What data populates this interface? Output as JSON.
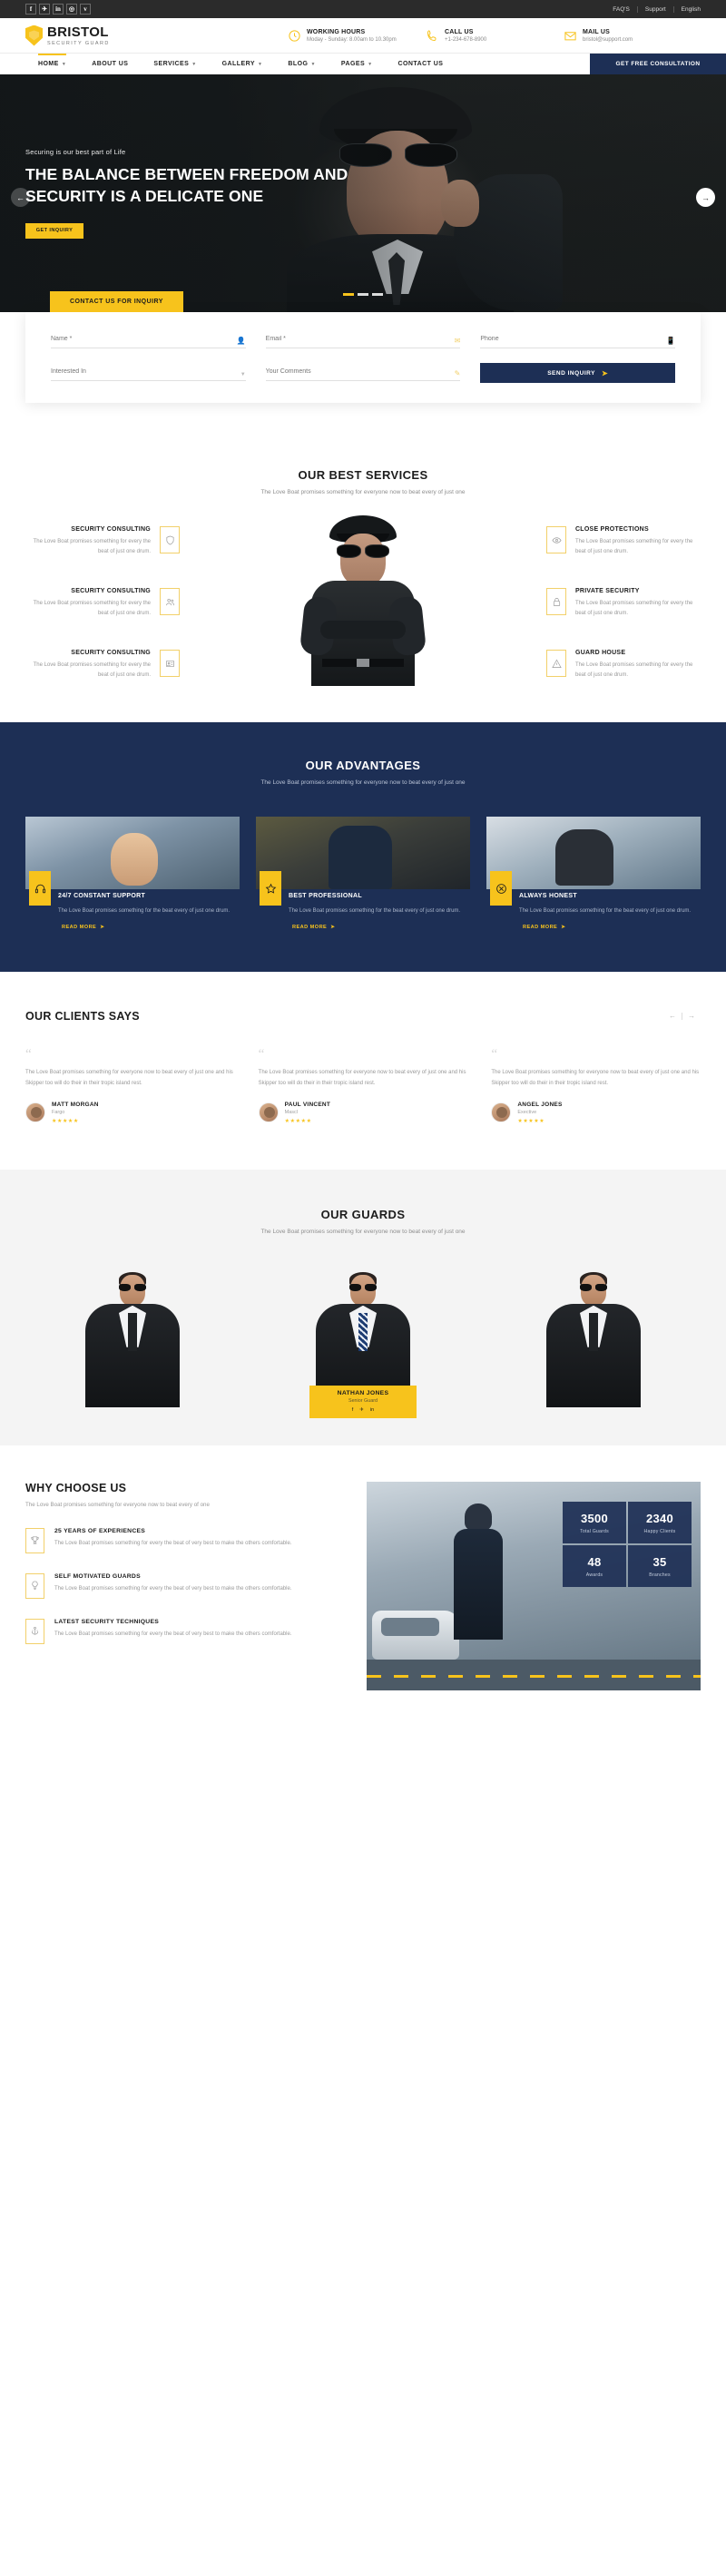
{
  "topbar": {
    "socials": [
      {
        "name": "facebook-icon",
        "glyph": "f"
      },
      {
        "name": "twitter-icon",
        "glyph": "✈"
      },
      {
        "name": "linkedin-icon",
        "glyph": "in"
      },
      {
        "name": "instagram-icon",
        "glyph": "◎"
      },
      {
        "name": "vimeo-icon",
        "glyph": "v"
      }
    ],
    "links": [
      "FAQ'S",
      "Support",
      "English"
    ]
  },
  "header": {
    "logo_main": "BRISTOL",
    "logo_sub": "SECURITY GUARD",
    "info": [
      {
        "title": "WORKING HOURS",
        "sub": "Moday - Sunday: 8.00am to 10.30pm",
        "icon": "clock-icon"
      },
      {
        "title": "CALL US",
        "sub": "+1-234-678-8900",
        "icon": "phone-icon"
      },
      {
        "title": "MAIL US",
        "sub": "bristol@support.com",
        "icon": "mail-icon"
      }
    ]
  },
  "nav": {
    "items": [
      {
        "label": "HOME",
        "caret": true,
        "active": true
      },
      {
        "label": "ABOUT US",
        "caret": false,
        "active": false
      },
      {
        "label": "SERVICES",
        "caret": true,
        "active": false
      },
      {
        "label": "GALLERY",
        "caret": true,
        "active": false
      },
      {
        "label": "BLOG",
        "caret": true,
        "active": false
      },
      {
        "label": "PAGES",
        "caret": true,
        "active": false
      },
      {
        "label": "CONTACT US",
        "caret": false,
        "active": false
      }
    ],
    "cta": "GET FREE CONSULTATION"
  },
  "hero": {
    "kicker": "Securing is our best part of Life",
    "title": "THE BALANCE BETWEEN FREEDOM AND SECURITY IS A DELICATE ONE",
    "cta": "GET INQUIRY",
    "prev": "←",
    "next": "→"
  },
  "inquiry": {
    "tab": "CONTACT US FOR INQUIRY",
    "fields": {
      "name": "Name *",
      "email": "Email *",
      "phone": "Phone",
      "interested": "Interested In",
      "comments": "Your Comments"
    },
    "submit": "SEND INQUIRY"
  },
  "services": {
    "title": "OUR BEST SERVICES",
    "subtitle": "The Love Boat promises something for everyone now to beat every of just one",
    "left": [
      {
        "name": "SECURITY CONSULTING",
        "desc": "The Love Boat promises something for every the beat of just one drum.",
        "icon": "shield-icon"
      },
      {
        "name": "SECURITY CONSULTING",
        "desc": "The Love Boat promises something for every the beat of just one drum.",
        "icon": "people-icon"
      },
      {
        "name": "SECURITY CONSULTING",
        "desc": "The Love Boat promises something for every the beat of just one drum.",
        "icon": "card-icon"
      }
    ],
    "right": [
      {
        "name": "CLOSE PROTECTIONS",
        "desc": "The Love Boat promises something for every the beat of just one drum.",
        "icon": "eye-icon"
      },
      {
        "name": "PRIVATE SECURITY",
        "desc": "The Love Boat promises something for every the beat of just one drum.",
        "icon": "lock-icon"
      },
      {
        "name": "GUARD HOUSE",
        "desc": "The Love Boat promises something for every the beat of just one drum.",
        "icon": "warning-icon"
      }
    ]
  },
  "advantages": {
    "title": "OUR ADVANTAGES",
    "subtitle": "The Love Boat promises something for everyone now to beat every of just one",
    "cards": [
      {
        "title": "24/7 CONSTANT SUPPORT",
        "desc": "The Love Boat promises something for the beat every of just one drum.",
        "more": "READ MORE",
        "icon": "headphones-icon"
      },
      {
        "title": "BEST PROFESSIONAL",
        "desc": "The Love Boat promises something for the beat every of just one drum.",
        "more": "READ MORE",
        "icon": "star-icon"
      },
      {
        "title": "ALWAYS HONEST",
        "desc": "The Love Boat promises something for the beat every of just one drum.",
        "more": "READ MORE",
        "icon": "badge-icon"
      }
    ]
  },
  "testimonials": {
    "title": "OUR CLIENTS SAYS",
    "prev": "←",
    "next": "→",
    "items": [
      {
        "text": "The Love Boat promises something for everyone now to beat every of just one and his Skipper too will do their in their tropic island rest.",
        "name": "MATT MORGAN",
        "role": "Fargo",
        "stars": "★★★★★"
      },
      {
        "text": "The Love Boat promises something for everyone now to beat every of just one and his Skipper too will do their in their tropic island rest.",
        "name": "PAUL VINCENT",
        "role": "Mascl",
        "stars": "★★★★★"
      },
      {
        "text": "The Love Boat promises something for everyone now to beat every of just one and his Skipper too will do their in their tropic island rest.",
        "name": "ANGEL JONES",
        "role": "Exective",
        "stars": "★★★★★"
      }
    ]
  },
  "guards": {
    "title": "OUR GUARDS",
    "subtitle": "The Love Boat promises something for everyone now to beat every of just one",
    "featured": {
      "name": "NATHAN JONES",
      "role": "Senior Guard",
      "socials": [
        "f",
        "✈",
        "in"
      ]
    }
  },
  "why": {
    "title": "WHY CHOOSE US",
    "subtitle": "The Love Boat promises something for everyone now to beat every of one",
    "items": [
      {
        "name": "25 YEARS OF EXPERIENCES",
        "desc": "The Love Boat promises something for every the beat of very best to make the others comfortable.",
        "icon": "trophy-icon"
      },
      {
        "name": "SELF MOTIVATED GUARDS",
        "desc": "The Love Boat promises something for every the beat of very best to make the others comfortable.",
        "icon": "bulb-icon"
      },
      {
        "name": "LATEST SECURITY TECHNIQUES",
        "desc": "The Love Boat promises something for every the beat of very best to make the others comfortable.",
        "icon": "anchor-icon"
      }
    ],
    "stats": [
      {
        "num": "3500",
        "label": "Total Guards"
      },
      {
        "num": "2340",
        "label": "Happy Clients"
      },
      {
        "num": "48",
        "label": "Awards"
      },
      {
        "num": "35",
        "label": "Branches"
      }
    ]
  },
  "colors": {
    "accent_yellow": "#f7c31c",
    "navy": "#1d2f55",
    "dark": "#2b2b2b"
  }
}
